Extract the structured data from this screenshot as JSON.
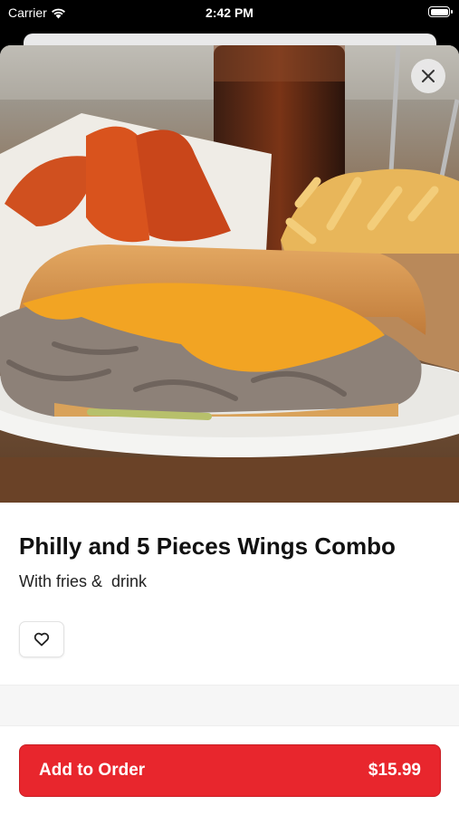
{
  "status_bar": {
    "carrier": "Carrier",
    "time": "2:42 PM"
  },
  "item": {
    "name": "Philly and 5 Pieces Wings Combo",
    "description": "With fries &  drink"
  },
  "order_button": {
    "label": "Add to Order",
    "price": "$15.99"
  },
  "colors": {
    "accent": "#e8262d",
    "sheet": "#ffffff",
    "divider": "#f6f6f6"
  },
  "icons": [
    "wifi-icon",
    "battery-icon",
    "close-icon",
    "heart-icon"
  ]
}
